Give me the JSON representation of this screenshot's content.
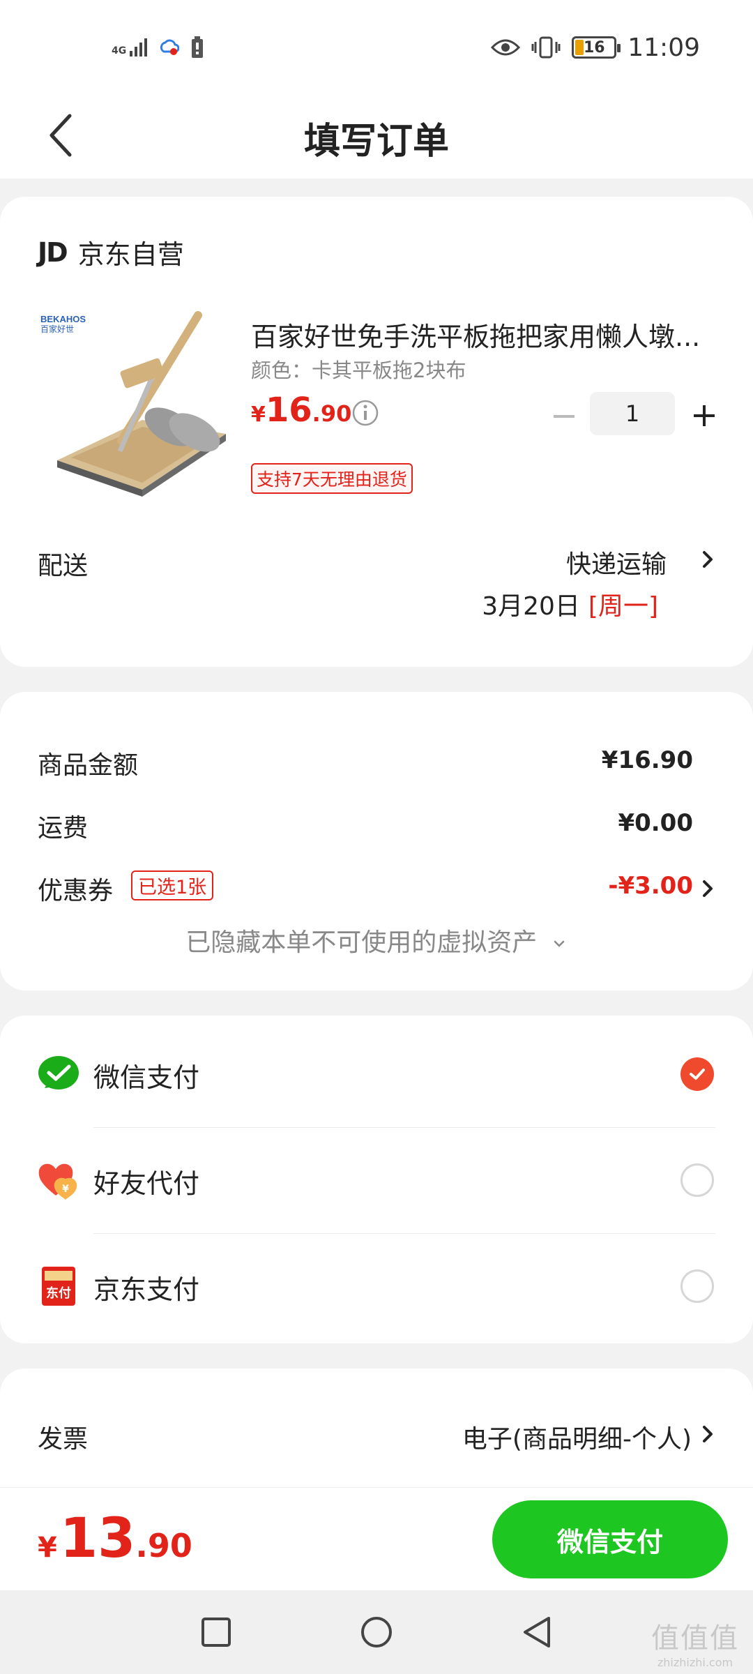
{
  "status_bar": {
    "network": "4G",
    "battery_level": "16",
    "time": "11:09"
  },
  "nav": {
    "title": "填写订单"
  },
  "store": {
    "logo_text": "JD",
    "name": "京东自营"
  },
  "product": {
    "title": "百家好世免手洗平板拖把家用懒人墩...",
    "spec": "颜色：卡其平板拖2块布",
    "price_symbol": "¥",
    "price_int": "16",
    "price_dec": ".90",
    "quantity": "1",
    "return_badge": "支持7天无理由退货"
  },
  "shipping": {
    "label": "配送",
    "method": "快递运输",
    "date": "3月20日",
    "weekday": "[周一]"
  },
  "amounts": {
    "goods_label": "商品金额",
    "goods_value": "¥16.90",
    "freight_label": "运费",
    "freight_value": "¥0.00",
    "coupon_label": "优惠券",
    "coupon_badge": "已选1张",
    "coupon_value": "-¥3.00",
    "hidden_assets": "已隐藏本单不可使用的虚拟资产"
  },
  "payment": {
    "options": [
      {
        "label": "微信支付",
        "icon": "wechat-pay-icon",
        "selected": true
      },
      {
        "label": "好友代付",
        "icon": "friend-pay-icon",
        "selected": false
      },
      {
        "label": "京东支付",
        "icon": "jd-pay-icon",
        "selected": false
      }
    ]
  },
  "invoice": {
    "label": "发票",
    "value": "电子(商品明细-个人)"
  },
  "bottom": {
    "total_symbol": "¥",
    "total_int": "13",
    "total_dec": ".90",
    "pay_button": "微信支付"
  },
  "watermark": {
    "main": "值值值",
    "sub": "zhizhizhi.com"
  },
  "colors": {
    "accent_red": "#e2231a",
    "pay_green": "#1ec622",
    "check_orange": "#f04a2e"
  }
}
